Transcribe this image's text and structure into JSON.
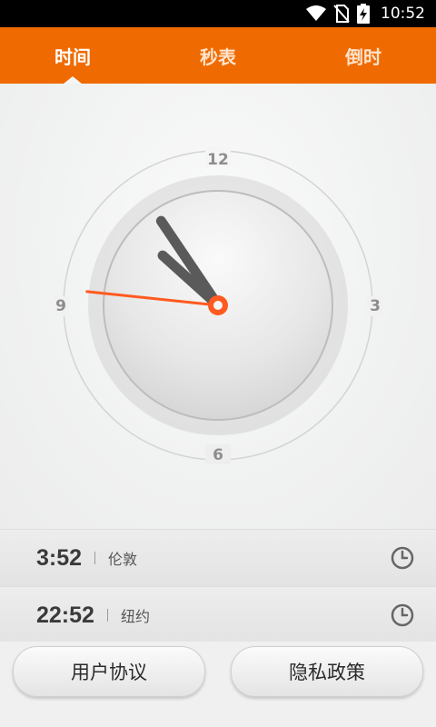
{
  "status_bar": {
    "time": "10:52",
    "icons": [
      "wifi-icon",
      "no-sim-icon",
      "battery-charging-icon"
    ]
  },
  "tabs": [
    {
      "label": "时间",
      "active": true
    },
    {
      "label": "秒表",
      "active": false
    },
    {
      "label": "倒时",
      "active": false
    }
  ],
  "clock": {
    "numerals": {
      "top": "12",
      "right": "3",
      "bottom": "6",
      "left": "9"
    },
    "hour": 10,
    "minute": 52,
    "second": 46,
    "accent_color": "#ff5a1f"
  },
  "world_clocks": [
    {
      "time": "3:52",
      "city": "伦敦"
    },
    {
      "time": "22:52",
      "city": "纽约"
    }
  ],
  "buttons": {
    "user_agreement": "用户协议",
    "privacy_policy": "隐私政策"
  },
  "colors": {
    "tab_bar": "#ef6a00",
    "status_bar": "#000000"
  }
}
